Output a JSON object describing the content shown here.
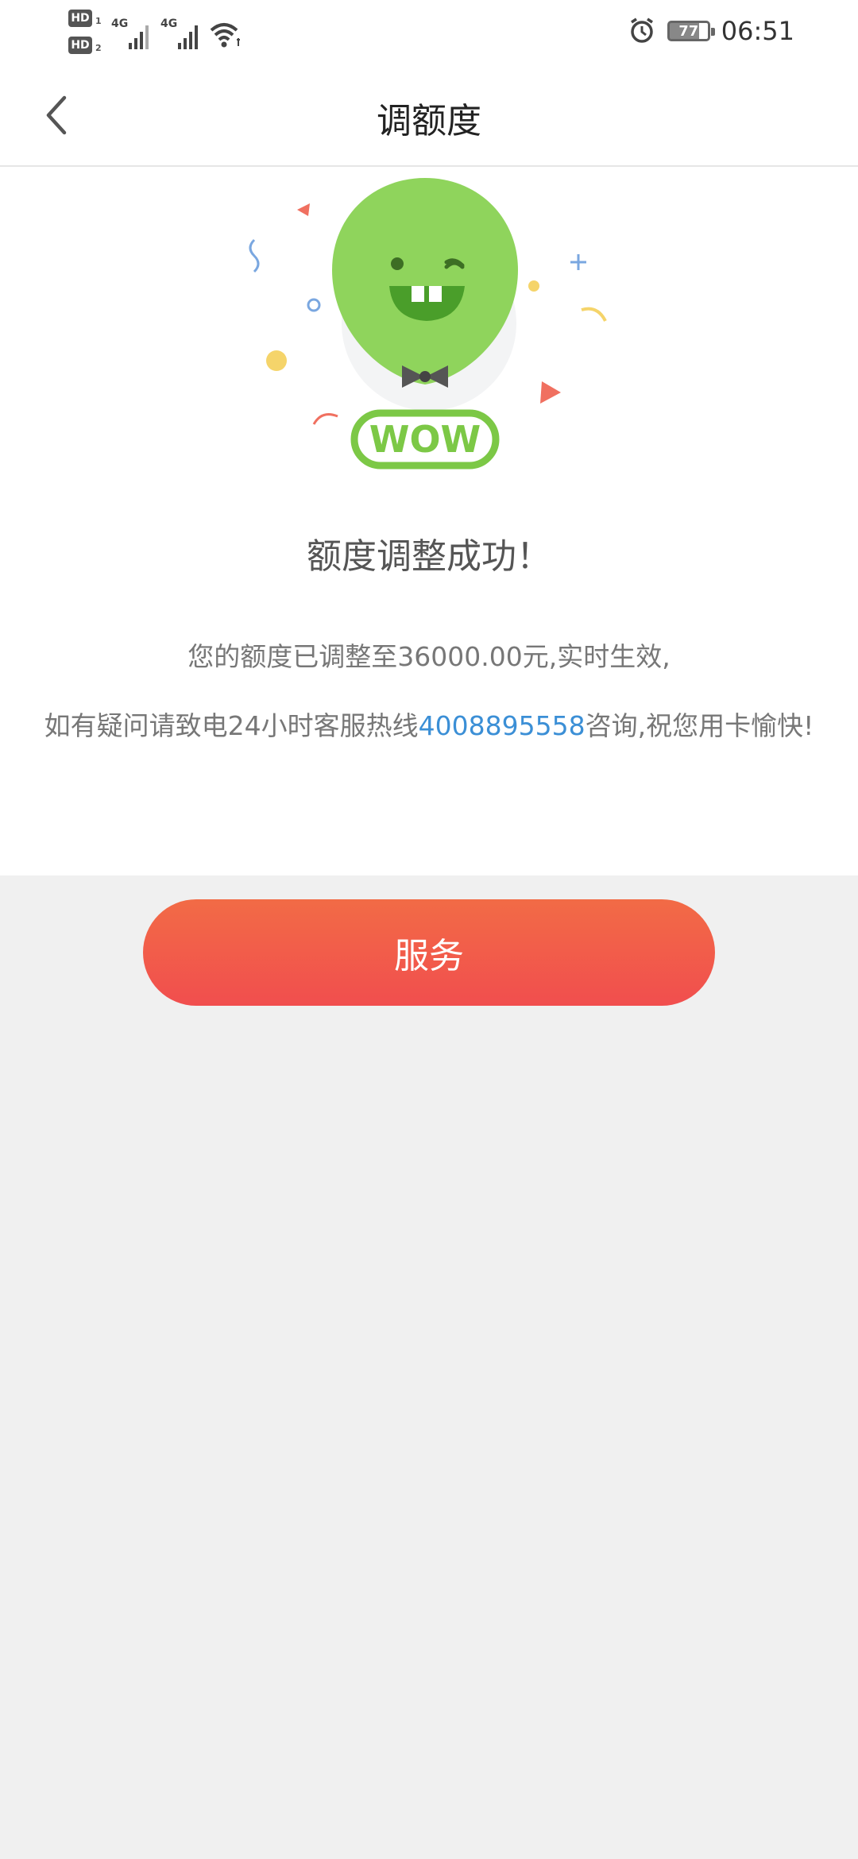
{
  "status_bar": {
    "hd1": "HD",
    "hd1_sub": "1",
    "hd2": "HD",
    "hd2_sub": "2",
    "net1": "4G",
    "net2": "4G",
    "battery": "77",
    "time": "06:51",
    "icons": [
      "signal-icon",
      "wifi-icon",
      "alarm-icon",
      "battery-icon"
    ]
  },
  "nav": {
    "title": "调额度",
    "back_icon": "chevron-left-icon"
  },
  "illustration": {
    "badge_text": "WOW",
    "colors": {
      "balloon": "#8fd45c",
      "badge": "#7cc846",
      "accent_red": "#f07060",
      "accent_blue": "#7aa7e0",
      "accent_yellow": "#f5d46a"
    }
  },
  "content": {
    "success_title": "额度调整成功！",
    "message_line1": "您的额度已调整至36000.00元,实时生效,",
    "message_line2_before": "如有疑问请致电24小时客服热线",
    "hotline": "4008895558",
    "message_line2_after": "咨询,祝您用卡愉快!"
  },
  "actions": {
    "service_label": "服务"
  },
  "colors": {
    "primary_button_top": "#f26b46",
    "primary_button_bottom": "#f14e4e",
    "link": "#3b8fd6",
    "background": "#f0f0f0"
  }
}
